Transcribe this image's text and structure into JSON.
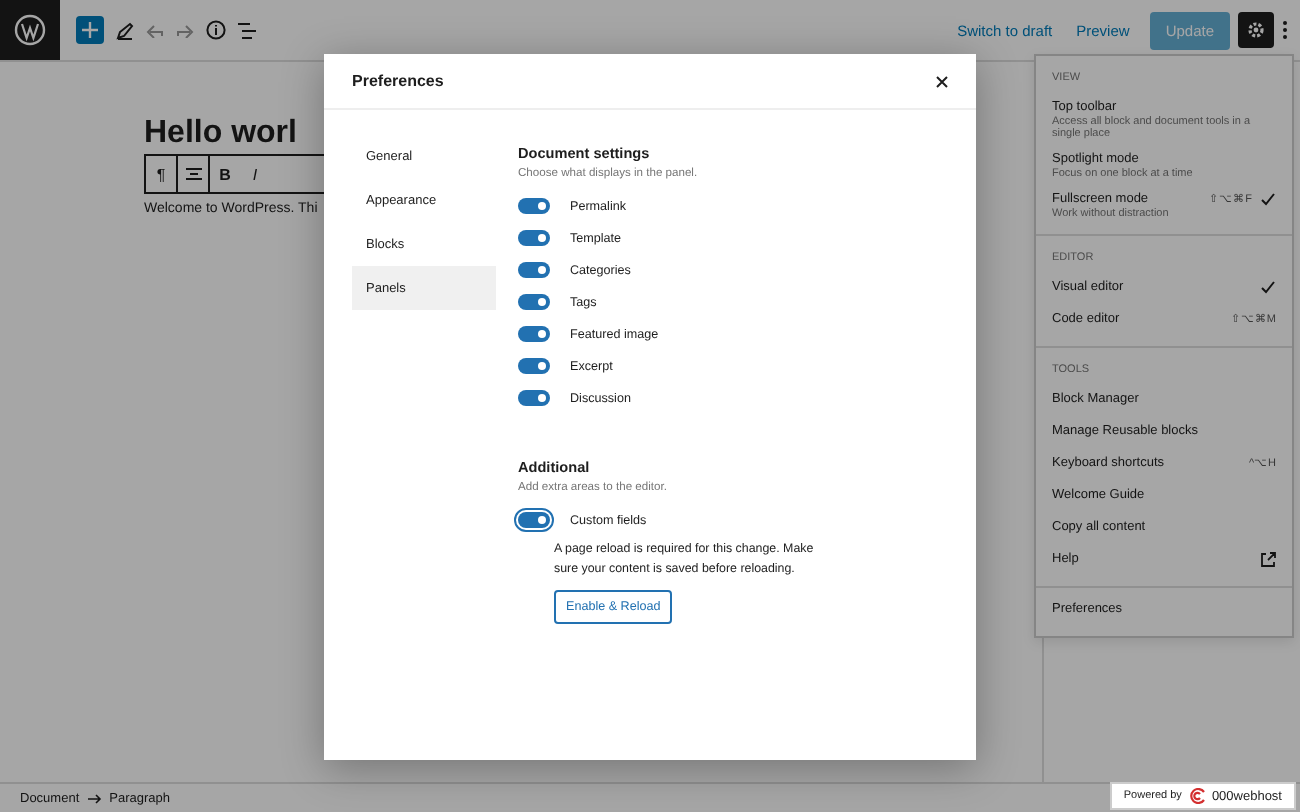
{
  "top_bar": {
    "switch_to_draft": "Switch to draft",
    "preview": "Preview",
    "update": "Update"
  },
  "editor": {
    "heading": "Hello worl",
    "paragraph": "Welcome to WordPress. Thi"
  },
  "block_toolbar": {
    "paragraph": "¶",
    "bold": "B",
    "italic": "I"
  },
  "options_menu": [
    {
      "heading": "VIEW",
      "items": [
        {
          "label": "Top toolbar",
          "description": "Access all block and document tools in a single place",
          "checked": false
        },
        {
          "label": "Spotlight mode",
          "description": "Focus on one block at a time",
          "checked": false
        },
        {
          "label": "Fullscreen mode",
          "description": "Work without distraction",
          "shortcut": "⇧⌥⌘F",
          "checked": true
        }
      ]
    },
    {
      "heading": "EDITOR",
      "items": [
        {
          "label": "Visual editor",
          "checked": true
        },
        {
          "label": "Code editor",
          "shortcut": "⇧⌥⌘M",
          "checked": false
        }
      ]
    },
    {
      "heading": "TOOLS",
      "items": [
        {
          "label": "Block Manager",
          "checked": false
        },
        {
          "label": "Manage Reusable blocks",
          "checked": false
        },
        {
          "label": "Keyboard shortcuts",
          "shortcut": "^⌥H",
          "checked": false
        },
        {
          "label": "Welcome Guide",
          "checked": false
        },
        {
          "label": "Copy all content",
          "checked": false
        },
        {
          "label": "Help",
          "kind": "external",
          "checked": false
        }
      ]
    },
    {
      "items": [
        {
          "label": "Preferences",
          "checked": false
        }
      ]
    }
  ],
  "modal": {
    "title": "Preferences",
    "nav": [
      {
        "label": "General",
        "selected": false
      },
      {
        "label": "Appearance",
        "selected": false
      },
      {
        "label": "Blocks",
        "selected": false
      },
      {
        "label": "Panels",
        "selected": true
      }
    ],
    "sections": [
      {
        "title": "Document settings",
        "description": "Choose what displays in the panel.",
        "toggles": [
          {
            "label": "Permalink",
            "on": true
          },
          {
            "label": "Template",
            "on": true
          },
          {
            "label": "Categories",
            "on": true
          },
          {
            "label": "Tags",
            "on": true
          },
          {
            "label": "Featured image",
            "on": true
          },
          {
            "label": "Excerpt",
            "on": true
          },
          {
            "label": "Discussion",
            "on": true
          }
        ]
      },
      {
        "title": "Additional",
        "description": "Add extra areas to the editor.",
        "toggles": [
          {
            "label": "Custom fields",
            "on": true,
            "focused": true,
            "notice": "A page reload is required for this change. Make sure your content is saved before reloading.",
            "button": "Enable & Reload"
          }
        ]
      }
    ]
  },
  "breadcrumb": [
    "Document",
    "Paragraph"
  ],
  "host_badge": {
    "prefix": "Powered by",
    "brand": "000webhost"
  }
}
